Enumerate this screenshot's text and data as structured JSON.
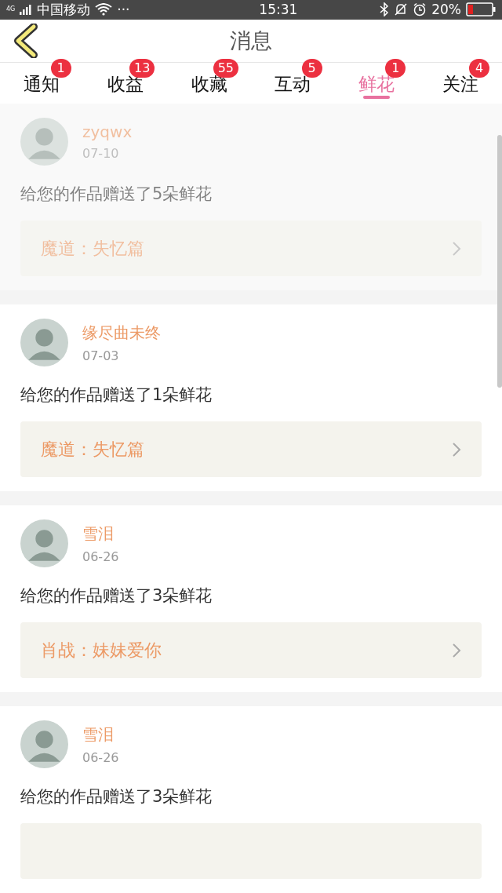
{
  "status_bar": {
    "network": "4G",
    "carrier": "中国移动",
    "more": "···",
    "time": "15:31",
    "battery_text": "20%"
  },
  "header": {
    "title": "消息"
  },
  "tabs": [
    {
      "label": "通知",
      "badge": "1",
      "selected": false
    },
    {
      "label": "收益",
      "badge": "13",
      "selected": false
    },
    {
      "label": "收藏",
      "badge": "55",
      "selected": false
    },
    {
      "label": "互动",
      "badge": "5",
      "selected": false
    },
    {
      "label": "鲜花",
      "badge": "1",
      "selected": true
    },
    {
      "label": "关注",
      "badge": "4",
      "selected": false
    }
  ],
  "messages": [
    {
      "name": "zyqwx",
      "date": "07-10",
      "text": "给您的作品赠送了5朵鲜花",
      "work": "魔道：失忆篇",
      "faded": true
    },
    {
      "name": "缘尽曲未终",
      "date": "07-03",
      "text": "给您的作品赠送了1朵鲜花",
      "work": "魔道：失忆篇",
      "faded": false
    },
    {
      "name": "雪泪",
      "date": "06-26",
      "text": "给您的作品赠送了3朵鲜花",
      "work": "肖战：妹妹爱你",
      "faded": false
    },
    {
      "name": "雪泪",
      "date": "06-26",
      "text": "给您的作品赠送了3朵鲜花",
      "faded": false
    }
  ]
}
